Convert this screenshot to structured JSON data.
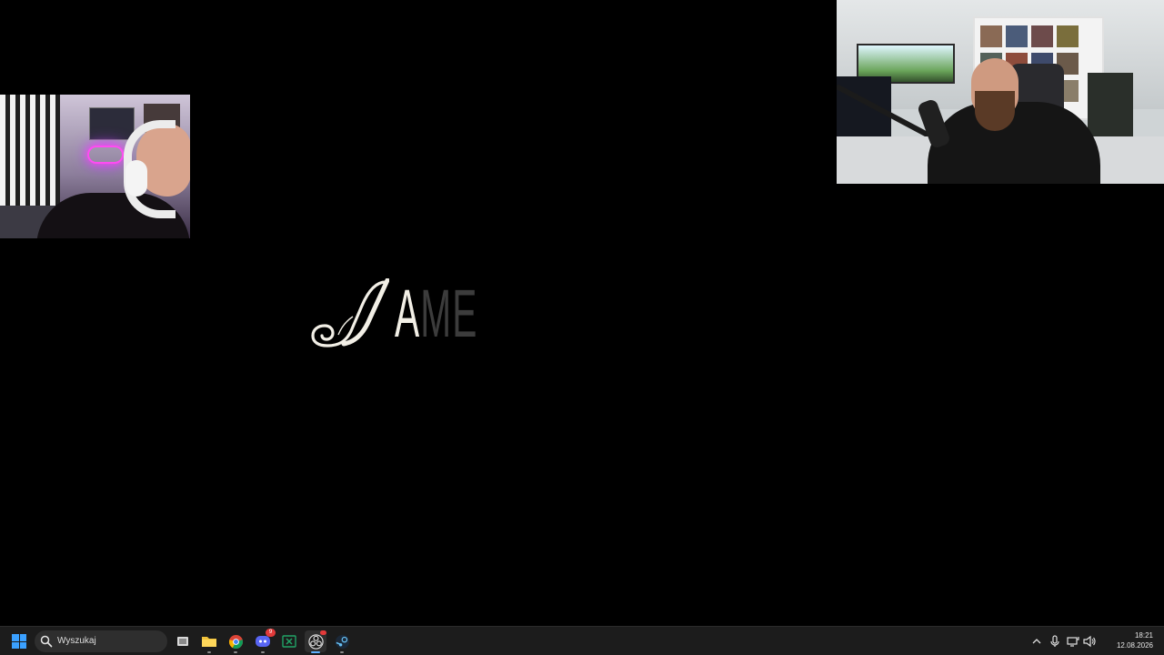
{
  "webcams": {
    "left": {
      "name": "streamer-webcam-left"
    },
    "right": {
      "name": "streamer-webcam-right"
    }
  },
  "game_logo": {
    "glyph": "J",
    "bright": "A",
    "faded": "ME",
    "colors": {
      "bright": "#f2efe6",
      "faded": "#3c3c3c"
    }
  },
  "taskbar": {
    "search": {
      "placeholder": "Wyszukaj"
    },
    "apps": [
      {
        "name": "start",
        "icon": "windows-icon"
      },
      {
        "name": "task-view",
        "icon": "task-view-icon"
      },
      {
        "name": "file-explorer",
        "icon": "folder-icon"
      },
      {
        "name": "chrome",
        "icon": "chrome-icon"
      },
      {
        "name": "discord",
        "icon": "discord-icon",
        "badge": "9"
      },
      {
        "name": "excel",
        "icon": "excel-icon"
      },
      {
        "name": "obs",
        "icon": "obs-icon",
        "active": true
      },
      {
        "name": "steam",
        "icon": "steam-icon"
      }
    ],
    "tray": {
      "icons": [
        "chevron-up-icon",
        "microphone-icon",
        "network-icon",
        "volume-icon"
      ],
      "time": "18:21",
      "date": "12.08.2026"
    },
    "colors": {
      "accent": "#3aa0ff",
      "background": "#1c1c1c"
    }
  }
}
